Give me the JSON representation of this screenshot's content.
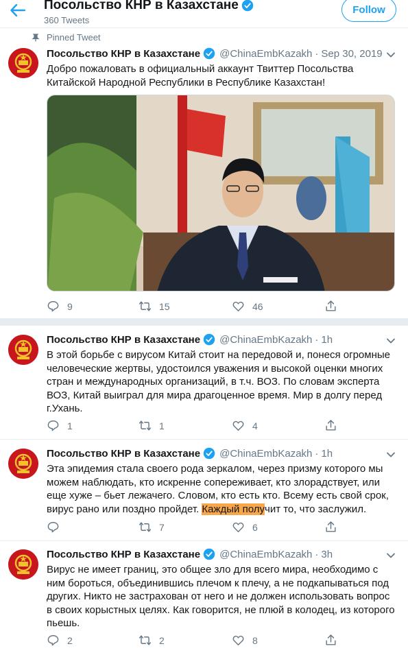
{
  "header": {
    "title": "Посольство КНР в Казахстане",
    "tweet_count": "360 Tweets",
    "follow_label": "Follow",
    "back_icon": "arrow-left-icon"
  },
  "colors": {
    "accent": "#1da1f2",
    "highlight": "#f7a64a",
    "avatar_red": "#c7171d",
    "muted": "#657786"
  },
  "tweets": [
    {
      "pinned_label": "Pinned Tweet",
      "name": "Посольство КНР в Казахстане",
      "handle": "@ChinaEmbKazakh",
      "dot": "·",
      "time": "Sep 30, 2019",
      "text": "Добро пожаловать в официальный аккаунт Твиттер Посольства Китайской Народной Республики в Республике Казахстан!",
      "replies": "9",
      "retweets": "15",
      "likes": "46"
    },
    {
      "name": "Посольство КНР в Казахстане",
      "handle": "@ChinaEmbKazakh",
      "dot": "·",
      "time": "1h",
      "text": "В этой борьбе с вирусом Китай стоит на передовой и, понеся огромные человеческие жертвы, удостоился уважения и высокой оценки многих стран и международных организаций, в т.ч. ВОЗ. По словам эксперта ВОЗ, Китай выиграл для мира драгоценное время. Мир в долгу перед г.Ухань.",
      "replies": "1",
      "retweets": "1",
      "likes": "4"
    },
    {
      "name": "Посольство КНР в Казахстане",
      "handle": "@ChinaEmbKazakh",
      "dot": "·",
      "time": "1h",
      "text_before": "Эта эпидемия стала своего рода зеркалом, через призму которого мы можем наблюдать, кто искренне сопереживает, кто злорадствует, или еще хуже – бьет лежачего. Словом, кто есть кто. Всему есть свой срок, вирус рано или поздно пройдет. ",
      "text_highlight": "Каждый полу",
      "text_after": "чит то, что заслужил.",
      "replies": "",
      "retweets": "7",
      "likes": "6"
    },
    {
      "name": "Посольство КНР в Казахстане",
      "handle": "@ChinaEmbKazakh",
      "dot": "·",
      "time": "3h",
      "text": "Вирус не имеет границ, это общее зло для всего мира, необходимо с ним бороться, объединившись плечом к плечу, а не подкапываться под других. Никто не застрахован от него и не должен использовать вопрос в своих корыстных целях. Как говорится, не плюй в колодец, из которого пьешь.",
      "replies": "2",
      "retweets": "2",
      "likes": "8"
    }
  ]
}
